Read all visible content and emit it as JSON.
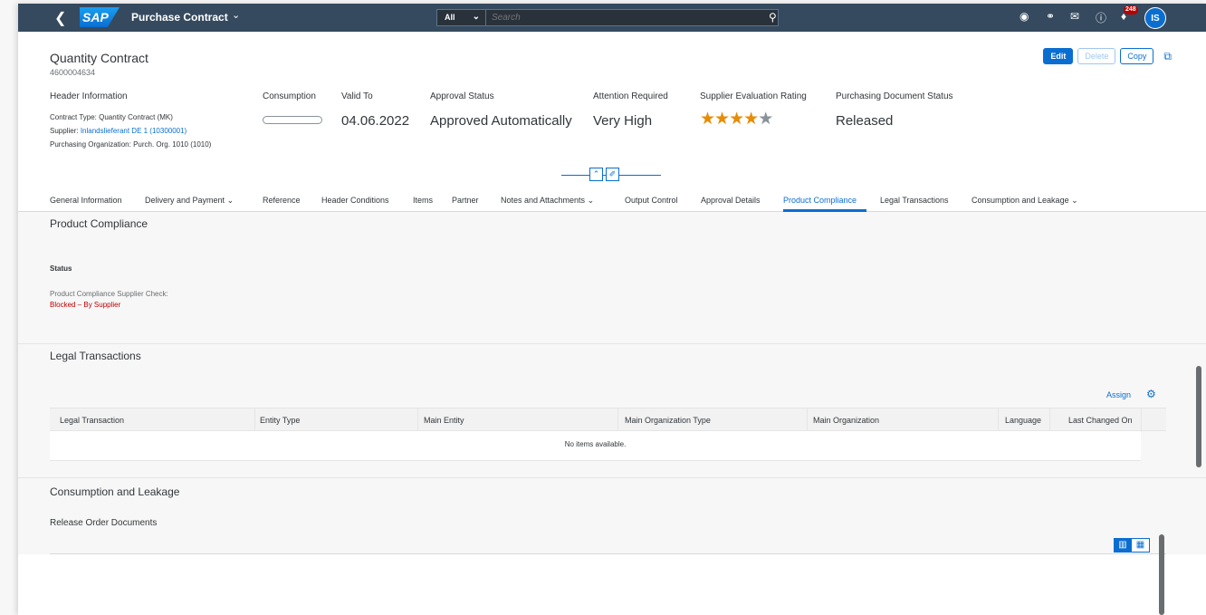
{
  "shell": {
    "app_title": "Purchase Contract",
    "scope": "All",
    "search_placeholder": "Search",
    "notification_count": "248",
    "avatar_initials": "IS"
  },
  "header": {
    "title": "Quantity Contract",
    "subtitle": "4600004634",
    "actions": {
      "edit": "Edit",
      "delete": "Delete",
      "copy": "Copy"
    },
    "header_info_label": "Header Information",
    "contract_type_label": "Contract Type:",
    "contract_type_value": "Quantity Contract (MK)",
    "supplier_label": "Supplier:",
    "supplier_value": "Inlandslieferant DE 1 (10300001)",
    "purch_org_label": "Purchasing Organization:",
    "purch_org_value": "Purch. Org. 1010 (1010)",
    "consumption_label": "Consumption",
    "consumption_percent": 0,
    "valid_to_label": "Valid To",
    "valid_to_value": "04.06.2022",
    "approval_label": "Approval Status",
    "approval_value": "Approved Automatically",
    "attention_label": "Attention Required",
    "attention_value": "Very High",
    "rating_label": "Supplier Evaluation Rating",
    "rating_value": 3.5,
    "rating_max": 5,
    "doc_status_label": "Purchasing Document Status",
    "doc_status_value": "Released"
  },
  "tabs": [
    "General Information",
    "Delivery and Payment",
    "Reference",
    "Header Conditions",
    "Items",
    "Partner",
    "Notes and Attachments",
    "Output Control",
    "Approval Details",
    "Product Compliance",
    "Legal Transactions",
    "Consumption and Leakage"
  ],
  "active_tab": "Product Compliance",
  "product_compliance": {
    "title": "Product Compliance",
    "status_label": "Status",
    "check_label": "Product Compliance Supplier Check:",
    "check_value": "Blocked – By Supplier",
    "check_value_color": "#bb0000"
  },
  "legal_transactions": {
    "title": "Legal Transactions",
    "assign_label": "Assign",
    "columns": [
      "Legal Transaction",
      "Entity Type",
      "Main Entity",
      "Main Organization Type",
      "Main Organization",
      "Language",
      "Last Changed On"
    ],
    "empty_text": "No items available."
  },
  "consumption_leakage": {
    "title": "Consumption and Leakage",
    "subtitle": "Release Order Documents"
  },
  "colors": {
    "shell_bg": "#354a5f",
    "accent": "#0a6ed1",
    "star": "#e78c07",
    "negative": "#bb0000"
  }
}
